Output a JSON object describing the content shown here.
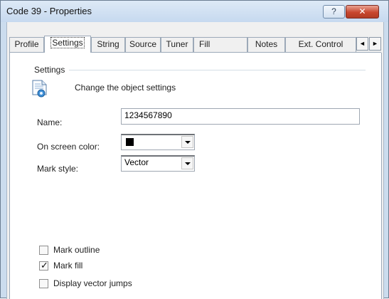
{
  "window": {
    "title": "Code 39 - Properties",
    "help_label": "?",
    "close_label": "✕"
  },
  "tabs": [
    "Profile",
    "Settings",
    "String",
    "Source",
    "Tuner",
    "Fill",
    "Notes",
    "Ext. Control"
  ],
  "active_tab": "Settings",
  "tab_scroll": {
    "left": "◄",
    "right": "►"
  },
  "settings": {
    "group_label": "Settings",
    "description": "Change the object settings",
    "name_label": "Name:",
    "name_value": "1234567890",
    "on_screen_color_label": "On screen color:",
    "on_screen_color_value": "#000000",
    "mark_style_label": "Mark style:",
    "mark_style_value": "Vector"
  },
  "checkboxes": [
    {
      "label": "Mark outline",
      "checked": false
    },
    {
      "label": "Mark fill",
      "checked": true
    },
    {
      "label": "Display vector jumps",
      "checked": false
    }
  ]
}
